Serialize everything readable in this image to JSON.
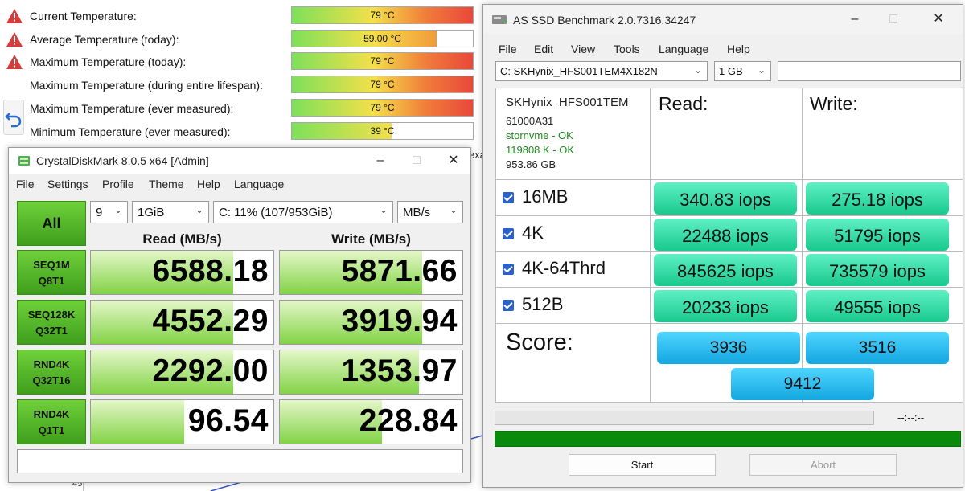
{
  "temps": {
    "rows": [
      {
        "label": "Current Temperature:",
        "value": "79 °C",
        "warn": true,
        "fill_pct": 100
      },
      {
        "label": "Average Temperature (today):",
        "value": "59.00 °C",
        "warn": true,
        "fill_pct": 80
      },
      {
        "label": "Maximum Temperature (today):",
        "value": "79 °C",
        "warn": true,
        "fill_pct": 100
      },
      {
        "label": "Maximum Temperature (during entire lifespan):",
        "value": "79 °C",
        "warn": false,
        "fill_pct": 100
      },
      {
        "label": "Maximum Temperature (ever measured):",
        "value": "79 °C",
        "warn": false,
        "fill_pct": 100
      },
      {
        "label": "Minimum Temperature (ever measured):",
        "value": "39 °C",
        "warn": false,
        "fill_pct": 55
      }
    ],
    "background_fragments": {
      "xa": "exa",
      "axis": "45"
    }
  },
  "cdm": {
    "title": "CrystalDiskMark 8.0.5 x64 [Admin]",
    "menu": [
      "File",
      "Settings",
      "Profile",
      "Theme",
      "Help",
      "Language"
    ],
    "all_label": "All",
    "count": "9",
    "size": "1GiB",
    "drive": "C: 11% (107/953GiB)",
    "unit": "MB/s",
    "read_header": "Read (MB/s)",
    "write_header": "Write (MB/s)",
    "tests": [
      {
        "l1": "SEQ1M",
        "l2": "Q8T1",
        "read": "6588.18",
        "write": "5871.66",
        "read_fill": 0.78,
        "write_fill": 0.78
      },
      {
        "l1": "SEQ128K",
        "l2": "Q32T1",
        "read": "4552.29",
        "write": "3919.94",
        "read_fill": 0.78,
        "write_fill": 0.78
      },
      {
        "l1": "RND4K",
        "l2": "Q32T16",
        "read": "2292.00",
        "write": "1353.97",
        "read_fill": 0.78,
        "write_fill": 0.76
      },
      {
        "l1": "RND4K",
        "l2": "Q1T1",
        "read": "96.54",
        "write": "228.84",
        "read_fill": 0.51,
        "write_fill": 0.56
      }
    ],
    "comment": ""
  },
  "asssd": {
    "title": "AS SSD Benchmark 2.0.7316.34247",
    "menu": [
      "File",
      "Edit",
      "View",
      "Tools",
      "Language",
      "Help"
    ],
    "drive": "C: SKHynix_HFS001TEM4X182N",
    "size": "1 GB",
    "info": {
      "model": "SKHynix_HFS001TEM",
      "firmware": "61000A31",
      "driver": "stornvme - OK",
      "align": "119808 K - OK",
      "capacity": "953.86 GB"
    },
    "read_header": "Read:",
    "write_header": "Write:",
    "rows": [
      {
        "label": "16MB",
        "read": "340.83 iops",
        "write": "275.18 iops"
      },
      {
        "label": "4K",
        "read": "22488 iops",
        "write": "51795 iops"
      },
      {
        "label": "4K-64Thrd",
        "read": "845625 iops",
        "write": "735579 iops"
      },
      {
        "label": "512B",
        "read": "20233 iops",
        "write": "49555 iops"
      }
    ],
    "score_label": "Score:",
    "score_read": "3936",
    "score_write": "3516",
    "score_total": "9412",
    "timer": "--:--:--",
    "progress_top_pct": 0,
    "progress_bottom_pct": 100,
    "start_label": "Start",
    "abort_label": "Abort"
  },
  "colors": {
    "hot_gradient": [
      "#7de05a",
      "#f4e04a",
      "#f07a3a",
      "#e8483a"
    ],
    "warm_gradient": [
      "#7de05a",
      "#f4e04a",
      "#f29a3a"
    ],
    "cool_gradient": [
      "#7de05a",
      "#f4e04a"
    ],
    "cdm_green": "#4fb526",
    "iops_green": "#2bd9a0",
    "score_blue": "#28b8ee",
    "progress_green": "#0a8a0a"
  }
}
